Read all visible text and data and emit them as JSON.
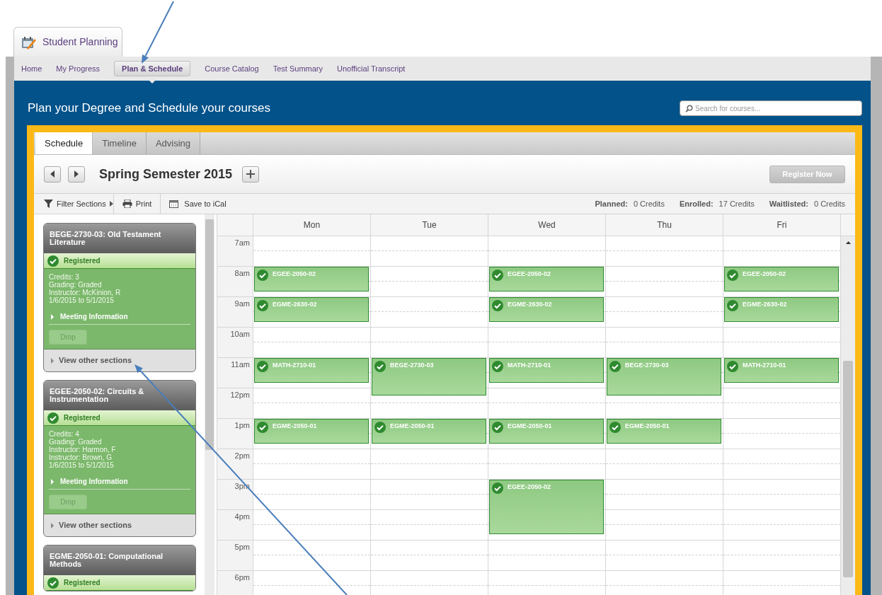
{
  "app_tab": {
    "label": "Student Planning"
  },
  "nav": [
    {
      "label": "Home",
      "selected": false
    },
    {
      "label": "My Progress",
      "selected": false
    },
    {
      "label": "Plan & Schedule",
      "selected": true
    },
    {
      "label": "Course Catalog",
      "selected": false
    },
    {
      "label": "Test Summary",
      "selected": false
    },
    {
      "label": "Unofficial Transcript",
      "selected": false
    }
  ],
  "header": {
    "title": "Plan your Degree and Schedule your courses",
    "search": {
      "placeholder": "Search for courses..."
    }
  },
  "tabs": [
    {
      "label": "Schedule",
      "selected": true
    },
    {
      "label": "Timeline",
      "selected": false
    },
    {
      "label": "Advising",
      "selected": false
    }
  ],
  "term": {
    "title": "Spring Semester 2015",
    "register_button": {
      "label": "Register Now",
      "disabled": true
    }
  },
  "toolbar": {
    "actions": [
      {
        "kind": "filter",
        "label": "Filter Sections"
      },
      {
        "kind": "print",
        "label": "Print"
      },
      {
        "kind": "ical",
        "label": "Save to iCal"
      }
    ],
    "totals": [
      {
        "label": "Planned:",
        "value": "0 Credits"
      },
      {
        "label": "Enrolled:",
        "value": "17 Credits"
      },
      {
        "label": "Waitlisted:",
        "value": "0 Credits"
      }
    ]
  },
  "courses": [
    {
      "title": "BEGE-2730-03: Old Testament Literature",
      "status": "Registered",
      "details": [
        "Credits: 3",
        "Grading: Graded",
        "Instructor: McKinion, R",
        "1/6/2015 to 5/1/2015"
      ],
      "meeting_label": "Meeting Information",
      "drop_button": {
        "label": "Drop",
        "disabled": true
      },
      "other_sections": "View other sections"
    },
    {
      "title": "EGEE-2050-02: Circuits & Instrumentation",
      "status": "Registered",
      "details": [
        "Credits: 4",
        "Grading: Graded",
        "Instructor: Harmon, F",
        "Instructor: Brown, G",
        "1/6/2015 to 5/1/2015"
      ],
      "meeting_label": "Meeting Information",
      "drop_button": {
        "label": "Drop",
        "disabled": true
      },
      "other_sections": "View other sections"
    },
    {
      "title": "EGME-2050-01: Computational Methods",
      "status": "Registered"
    }
  ],
  "calendar": {
    "days": [
      "Mon",
      "Tue",
      "Wed",
      "Thu",
      "Fri"
    ],
    "rows": [
      {
        "time": "7am",
        "cells": [
          {
            "kind": "free"
          },
          {
            "kind": "free"
          },
          {
            "kind": "free"
          },
          {
            "kind": "free"
          },
          {
            "kind": "free"
          }
        ]
      },
      {
        "time": "8am",
        "cells": [
          {
            "kind": "short",
            "code": "EGEE-2050-02"
          },
          {
            "kind": "free"
          },
          {
            "kind": "short",
            "code": "EGEE-2050-02"
          },
          {
            "kind": "free"
          },
          {
            "kind": "short",
            "code": "EGEE-2050-02"
          }
        ]
      },
      {
        "time": "9am",
        "cells": [
          {
            "kind": "short",
            "code": "EGME-2630-02"
          },
          {
            "kind": "free"
          },
          {
            "kind": "short",
            "code": "EGME-2630-02"
          },
          {
            "kind": "free"
          },
          {
            "kind": "short",
            "code": "EGME-2630-02"
          }
        ]
      },
      {
        "time": "10am",
        "cells": [
          {
            "kind": "free"
          },
          {
            "kind": "free"
          },
          {
            "kind": "free"
          },
          {
            "kind": "free"
          },
          {
            "kind": "free"
          }
        ]
      },
      {
        "time": "11am",
        "cells": [
          {
            "kind": "short",
            "code": "MATH-2710-01"
          },
          {
            "kind": "medium",
            "code": "BEGE-2730-03"
          },
          {
            "kind": "short",
            "code": "MATH-2710-01"
          },
          {
            "kind": "medium",
            "code": "BEGE-2730-03"
          },
          {
            "kind": "short",
            "code": "MATH-2710-01"
          }
        ]
      },
      {
        "time": "12pm",
        "cells": [
          {
            "kind": "free"
          },
          {
            "kind": "free"
          },
          {
            "kind": "free"
          },
          {
            "kind": "free"
          },
          {
            "kind": "free"
          }
        ]
      },
      {
        "time": "1pm",
        "cells": [
          {
            "kind": "short",
            "code": "EGME-2050-01"
          },
          {
            "kind": "short",
            "code": "EGME-2050-01"
          },
          {
            "kind": "short",
            "code": "EGME-2050-01"
          },
          {
            "kind": "short",
            "code": "EGME-2050-01"
          },
          {
            "kind": "free"
          }
        ]
      },
      {
        "time": "2pm",
        "cells": [
          {
            "kind": "free"
          },
          {
            "kind": "free"
          },
          {
            "kind": "free"
          },
          {
            "kind": "free"
          },
          {
            "kind": "free"
          }
        ]
      },
      {
        "time": "3pm",
        "cells": [
          {
            "kind": "free"
          },
          {
            "kind": "free"
          },
          {
            "kind": "long",
            "code": "EGEE-2050-02"
          },
          {
            "kind": "free"
          },
          {
            "kind": "free"
          }
        ]
      },
      {
        "time": "4pm",
        "cells": [
          {
            "kind": "free"
          },
          {
            "kind": "free"
          },
          {
            "kind": "free"
          },
          {
            "kind": "free"
          },
          {
            "kind": "free"
          }
        ]
      },
      {
        "time": "5pm",
        "cells": [
          {
            "kind": "free"
          },
          {
            "kind": "free"
          },
          {
            "kind": "free"
          },
          {
            "kind": "free"
          },
          {
            "kind": "free"
          }
        ]
      },
      {
        "time": "6pm",
        "cells": [
          {
            "kind": "free"
          },
          {
            "kind": "free"
          },
          {
            "kind": "free"
          },
          {
            "kind": "free"
          },
          {
            "kind": "free"
          }
        ]
      }
    ]
  }
}
